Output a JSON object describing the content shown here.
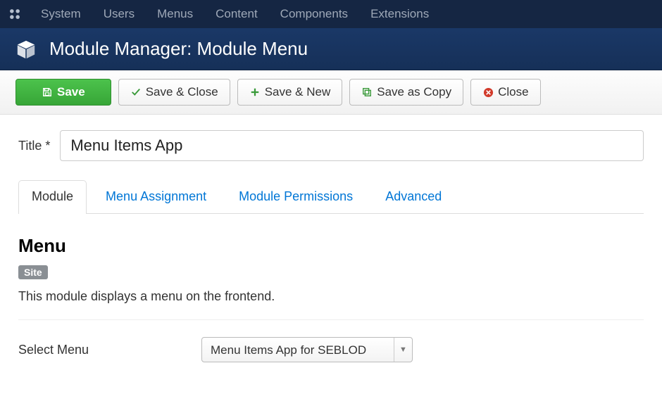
{
  "topmenu": {
    "items": [
      "System",
      "Users",
      "Menus",
      "Content",
      "Components",
      "Extensions"
    ]
  },
  "header": {
    "title": "Module Manager: Module Menu"
  },
  "toolbar": {
    "save": "Save",
    "save_close": "Save & Close",
    "save_new": "Save & New",
    "save_copy": "Save as Copy",
    "close": "Close"
  },
  "form": {
    "title_label": "Title *",
    "title_value": "Menu Items App"
  },
  "tabs": {
    "module": "Module",
    "menu_assignment": "Menu Assignment",
    "module_permissions": "Module Permissions",
    "advanced": "Advanced"
  },
  "module_tab": {
    "heading": "Menu",
    "badge": "Site",
    "description": "This module displays a menu on the frontend.",
    "select_menu_label": "Select Menu",
    "select_menu_value": "Menu Items App for SEBLOD"
  }
}
